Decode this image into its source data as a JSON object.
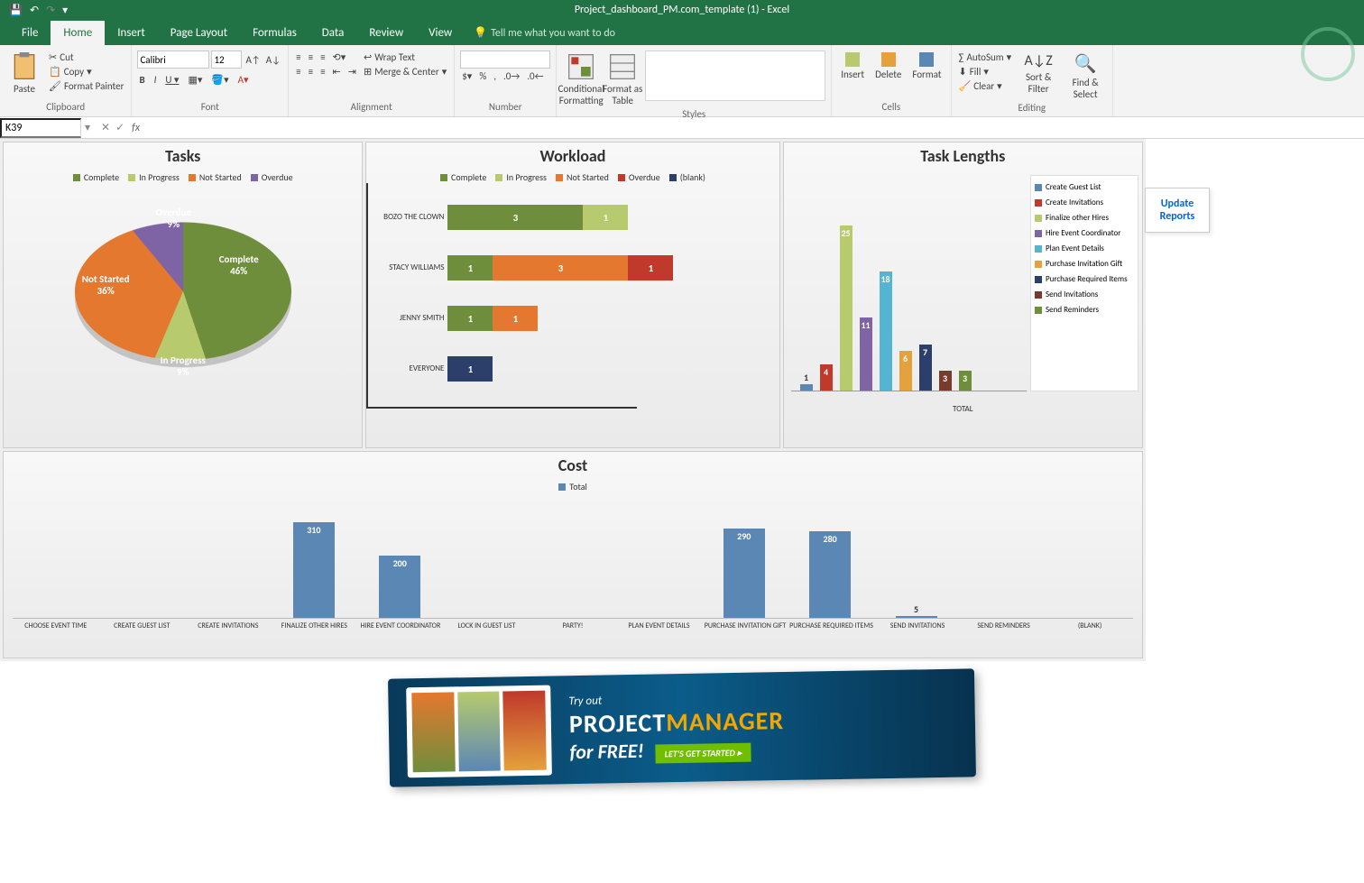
{
  "app": {
    "title": "Project_dashboard_PM.com_template (1) - Excel"
  },
  "qat": {
    "save": "💾",
    "undo": "↶",
    "redo": "↷",
    "custom": "▾"
  },
  "tabs": [
    "File",
    "Home",
    "Insert",
    "Page Layout",
    "Formulas",
    "Data",
    "Review",
    "View"
  ],
  "activeTab": "Home",
  "tellme": "Tell me what you want to do",
  "ribbon": {
    "clipboard": {
      "label": "Clipboard",
      "paste": "Paste",
      "cut": "Cut",
      "copy": "Copy",
      "painter": "Format Painter"
    },
    "font": {
      "label": "Font",
      "name": "Calibri",
      "size": "12"
    },
    "alignment": {
      "label": "Alignment",
      "wrap": "Wrap Text",
      "merge": "Merge & Center"
    },
    "number": {
      "label": "Number"
    },
    "styles": {
      "label": "Styles",
      "cond": "Conditional Formatting",
      "table": "Format as Table"
    },
    "cells": {
      "label": "Cells",
      "insert": "Insert",
      "delete": "Delete",
      "format": "Format"
    },
    "editing": {
      "label": "Editing",
      "autosum": "AutoSum",
      "fill": "Fill",
      "clear": "Clear",
      "sort": "Sort & Filter",
      "find": "Find & Select"
    }
  },
  "formula": {
    "cell": "K39",
    "value": ""
  },
  "sidebar": {
    "update1": "Update",
    "update2": "Reports"
  },
  "colors": {
    "complete": "#6f8e3c",
    "inprogress": "#b7ca6d",
    "notstarted": "#e4782e",
    "overdue": "#c0392b",
    "overduePurple": "#7e63a5",
    "blank": "#2c3e6a",
    "costbar": "#5b87b5"
  },
  "chart_data": [
    {
      "id": "tasks",
      "type": "pie",
      "title": "Tasks",
      "legend": [
        "Complete",
        "In Progress",
        "Not Started",
        "Overdue"
      ],
      "slices": [
        {
          "label": "Complete",
          "percent": 46,
          "color": "#6f8e3c"
        },
        {
          "label": "In Progress",
          "percent": 9,
          "color": "#b7ca6d"
        },
        {
          "label": "Not Started",
          "percent": 36,
          "color": "#e4782e"
        },
        {
          "label": "Overdue",
          "percent": 9,
          "color": "#7e63a5"
        }
      ]
    },
    {
      "id": "workload",
      "type": "bar",
      "title": "Workload",
      "legend": [
        "Complete",
        "In Progress",
        "Not Started",
        "Overdue",
        "(blank)"
      ],
      "categories": [
        "BOZO THE CLOWN",
        "STACY WILLIAMS",
        "JENNY SMITH",
        "EVERYONE"
      ],
      "series": [
        {
          "name": "Complete",
          "color": "#6f8e3c",
          "values": [
            3,
            1,
            1,
            0
          ]
        },
        {
          "name": "In Progress",
          "color": "#b7ca6d",
          "values": [
            1,
            0,
            0,
            0
          ]
        },
        {
          "name": "Not Started",
          "color": "#e4782e",
          "values": [
            0,
            3,
            1,
            0
          ]
        },
        {
          "name": "Overdue",
          "color": "#c0392b",
          "values": [
            0,
            1,
            0,
            0
          ]
        },
        {
          "name": "(blank)",
          "color": "#2c3e6a",
          "values": [
            0,
            0,
            0,
            1
          ]
        }
      ],
      "xlim": [
        0,
        6
      ]
    },
    {
      "id": "task_lengths",
      "type": "bar",
      "title": "Task Lengths",
      "xlabel": "TOTAL",
      "categories": [
        "Create Guest List",
        "Create Invitations",
        "Finalize other Hires",
        "Hire Event Coordinator",
        "Plan Event Details",
        "Purchase Invitation Gift",
        "Purchase Required Items",
        "Send Invitations",
        "Send Reminders"
      ],
      "values": [
        1,
        4,
        25,
        11,
        18,
        6,
        7,
        3,
        3
      ],
      "colors": [
        "#5b87b5",
        "#c0392b",
        "#b7ca6d",
        "#7e63a5",
        "#56b4d3",
        "#e4a13c",
        "#2c3e6a",
        "#7a3a2c",
        "#6f8e3c"
      ],
      "ylim": [
        0,
        30
      ]
    },
    {
      "id": "cost",
      "type": "bar",
      "title": "Cost",
      "legend": [
        "Total"
      ],
      "categories": [
        "CHOOSE EVENT TIME",
        "CREATE GUEST LIST",
        "CREATE INVITATIONS",
        "FINALIZE OTHER HIRES",
        "HIRE EVENT COORDINATOR",
        "LOCK IN GUEST LIST",
        "PARTY!",
        "PLAN EVENT DETAILS",
        "PURCHASE INVITATION GIFT",
        "PURCHASE REQUIRED ITEMS",
        "SEND INVITATIONS",
        "SEND REMINDERS",
        "(BLANK)"
      ],
      "values": [
        0,
        0,
        0,
        310,
        200,
        0,
        0,
        0,
        290,
        280,
        5,
        0,
        0
      ],
      "ylim": [
        0,
        350
      ]
    }
  ],
  "ad": {
    "line1": "Try out",
    "brand1": "PROJECT",
    "brand2": "MANAGER",
    "line3": "for FREE!",
    "btn": "LET'S GET STARTED ▸"
  }
}
